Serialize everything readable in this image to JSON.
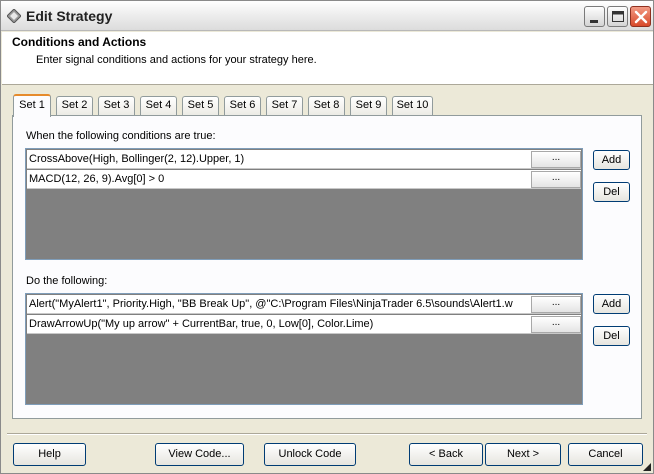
{
  "window": {
    "title": "Edit Strategy",
    "controls": {
      "minimize": "minimize",
      "maximize": "maximize",
      "close": "close"
    }
  },
  "header": {
    "title": "Conditions and Actions",
    "subtitle": "Enter signal conditions and actions for your strategy here."
  },
  "tabs": [
    "Set 1",
    "Set 2",
    "Set 3",
    "Set 4",
    "Set 5",
    "Set 6",
    "Set 7",
    "Set 8",
    "Set 9",
    "Set 10"
  ],
  "active_tab": "Set 1",
  "conditions": {
    "label": "When the following conditions are true:",
    "rows": [
      {
        "text": "CrossAbove(High, Bollinger(2, 12).Upper, 1)",
        "button": "..."
      },
      {
        "text": "MACD(12, 26, 9).Avg[0] > 0",
        "button": "..."
      }
    ],
    "add_label": "Add",
    "del_label": "Del"
  },
  "actions": {
    "label": "Do the following:",
    "rows": [
      {
        "text": "Alert(\"MyAlert1\", Priority.High, \"BB Break Up\", @\"C:\\Program Files\\NinjaTrader 6.5\\sounds\\Alert1.w",
        "button": "..."
      },
      {
        "text": "DrawArrowUp(\"My up arrow\" + CurrentBar, true, 0, Low[0], Color.Lime)",
        "button": "..."
      }
    ],
    "add_label": "Add",
    "del_label": "Del"
  },
  "footer": {
    "help": "Help",
    "view_code": "View Code...",
    "unlock_code": "Unlock Code",
    "back": "< Back",
    "next": "Next >",
    "cancel": "Cancel"
  },
  "colors": {
    "dialog_bg": "#ECE9D8",
    "grid_empty": "#808080",
    "active_tab_accent": "#E68B2C",
    "close_button": "#D8492A"
  }
}
